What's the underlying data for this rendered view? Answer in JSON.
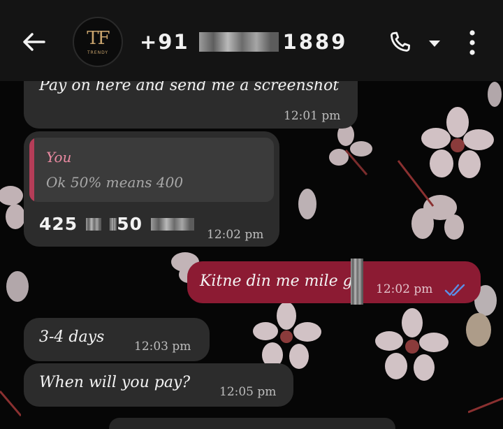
{
  "header": {
    "contact_prefix": "+91",
    "contact_suffix": "1889",
    "avatar_monogram": "TF",
    "avatar_subtitle": "TRENDY",
    "back_icon": "arrow-left-icon",
    "call_icon": "phone-icon",
    "dropdown_icon": "caret-down-icon",
    "menu_icon": "more-vert-icon"
  },
  "messages": [
    {
      "direction": "incoming",
      "text": "Pay on here and send me a screenshot",
      "time": "12:01 pm"
    },
    {
      "direction": "incoming",
      "quote_sender": "You",
      "quote_text": "Ok 50% means 400",
      "text_start": "425",
      "text_mid": "50",
      "time": "12:02 pm"
    },
    {
      "direction": "outgoing",
      "text": "Kitne din me mile g",
      "time": "12:02 pm",
      "status": "read"
    },
    {
      "direction": "incoming",
      "text": "3-4 days",
      "time": "12:03 pm"
    },
    {
      "direction": "incoming",
      "text": "When will you pay?",
      "time": "12:05 pm"
    }
  ],
  "colors": {
    "outgoing_bubble": "#8c1b33",
    "incoming_bubble": "#2c2c2c",
    "quote_accent": "#b53d58",
    "read_ticks": "#5b8fe6"
  }
}
